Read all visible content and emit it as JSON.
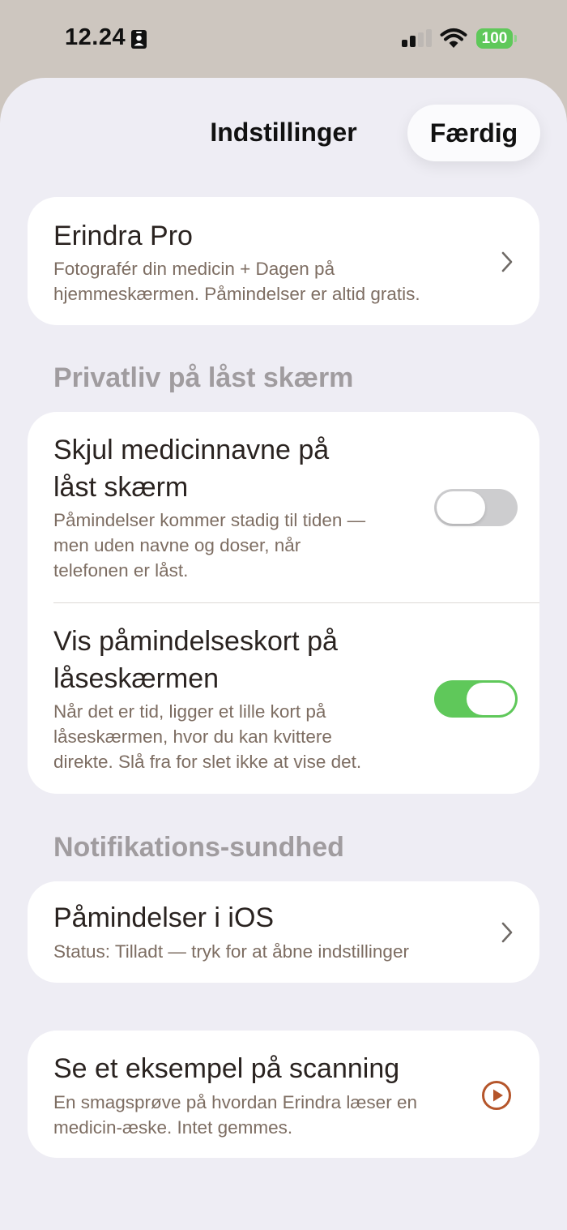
{
  "status_bar": {
    "time": "12.24",
    "battery": "100",
    "colors": {
      "battery": "#5fc85a"
    }
  },
  "header": {
    "title": "Indstillinger",
    "done_label": "Færdig"
  },
  "pro": {
    "title": "Erindra Pro",
    "subtitle_line1": "Fotografér din medicin + Dagen på",
    "subtitle_line2": "hjemmeskærmen. Påmindelser er altid gratis."
  },
  "privacy": {
    "header": "Privatliv på låst skærm",
    "hide_names": {
      "title_line1": "Skjul medicinnavne på",
      "title_line2": "låst skærm",
      "sub_line1": "Påmindelser kommer stadig til tiden —",
      "sub_line2": "men uden navne og doser, når",
      "sub_line3": "telefonen er låst.",
      "enabled": false
    },
    "show_cards": {
      "title_line1": "Vis påmindelseskort på",
      "title_line2": "låseskærmen",
      "sub_line1": "Når det er tid, ligger et lille kort på",
      "sub_line2": "låseskærmen, hvor du kan kvittere",
      "sub_line3": "direkte. Slå fra for slet ikke at vise det.",
      "enabled": true
    }
  },
  "notifications": {
    "header": "Notifikations-sundhed",
    "ios": {
      "title": "Påmindelser i iOS",
      "subtitle": "Status: Tilladt — tryk for at åbne indstillinger"
    }
  },
  "example": {
    "title": "Se et eksempel på scanning",
    "sub_line1": "En smagsprøve på hvordan Erindra læser en",
    "sub_line2": "medicin-æske. Intet gemmes."
  },
  "icons": {
    "id": "person-badge-icon",
    "signal": "cellular-signal-icon",
    "wifi": "wifi-icon",
    "chevron": "chevron-right-icon",
    "play": "play-circle-icon"
  },
  "colors": {
    "toggle_on": "#5fc85a",
    "toggle_off": "#cdcdcf",
    "accent_play": "#b5552a",
    "sheet_bg": "#eeedf4",
    "top_bg": "#cdc6bf"
  }
}
